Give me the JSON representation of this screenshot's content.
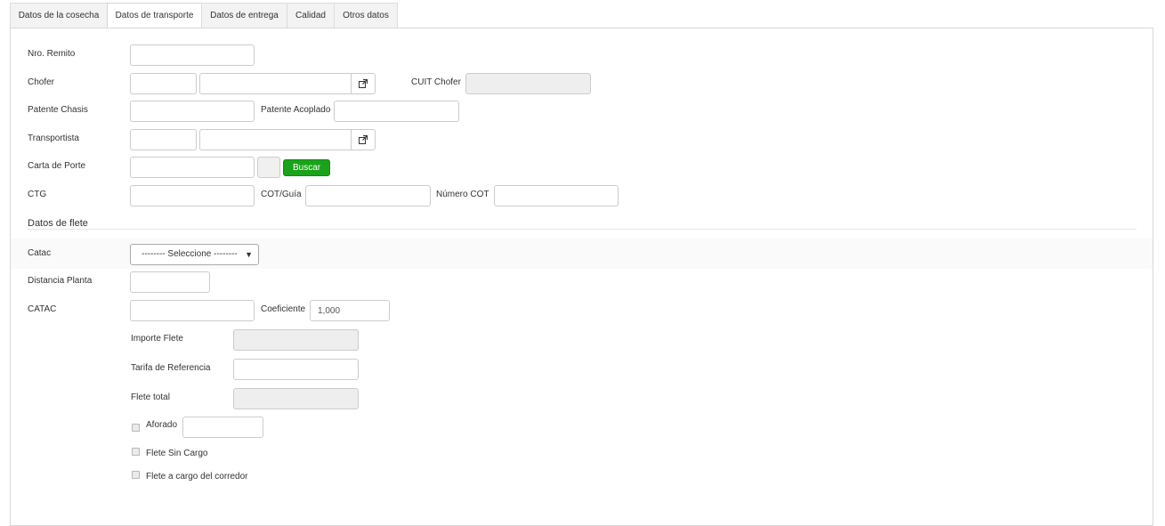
{
  "tabs": [
    {
      "label": "Datos de la cosecha",
      "active": false
    },
    {
      "label": "Datos de transporte",
      "active": true
    },
    {
      "label": "Datos de entrega",
      "active": false
    },
    {
      "label": "Calidad",
      "active": false
    },
    {
      "label": "Otros datos",
      "active": false
    }
  ],
  "form": {
    "nro_remito_label": "Nro. Remito",
    "nro_remito_value": "",
    "chofer_label": "Chofer",
    "chofer_code": "",
    "chofer_name": "",
    "cuit_chofer_label": "CUIT Chofer",
    "cuit_chofer_value": "",
    "patente_chasis_label": "Patente Chasis",
    "patente_chasis_value": "",
    "patente_acoplado_label": "Patente Acoplado",
    "patente_acoplado_value": "",
    "transportista_label": "Transportista",
    "transportista_code": "",
    "transportista_name": "",
    "carta_porte_label": "Carta de Porte",
    "carta_porte_value": "",
    "buscar_label": "Buscar",
    "ctg_label": "CTG",
    "ctg_value": "",
    "cot_guia_label": "COT/Guía",
    "cot_guia_value": "",
    "numero_cot_label": "Número COT",
    "numero_cot_value": ""
  },
  "flete": {
    "section_title": "Datos de flete",
    "catac_label": "Catac",
    "catac_selected": "-------- Seleccione --------",
    "distancia_label": "Distancia Planta",
    "distancia_value": "",
    "catac_upper_label": "CATAC",
    "catac_upper_value": "",
    "coeficiente_label": "Coeficiente",
    "coeficiente_value": "1,000",
    "importe_flete_label": "Importe Flete",
    "importe_flete_value": "",
    "tarifa_label": "Tarifa de Referencia",
    "tarifa_value": "",
    "flete_total_label": "Flete total",
    "flete_total_value": "",
    "aforado_label": "Aforado",
    "aforado_value": "",
    "flete_sin_cargo_label": "Flete Sin Cargo",
    "flete_cargo_corredor_label": "Flete a cargo del corredor"
  },
  "icons": {
    "external_link": "external-link-icon",
    "dropdown": "chevron-down-icon"
  },
  "colors": {
    "buscar_button": "#1aa31a"
  }
}
